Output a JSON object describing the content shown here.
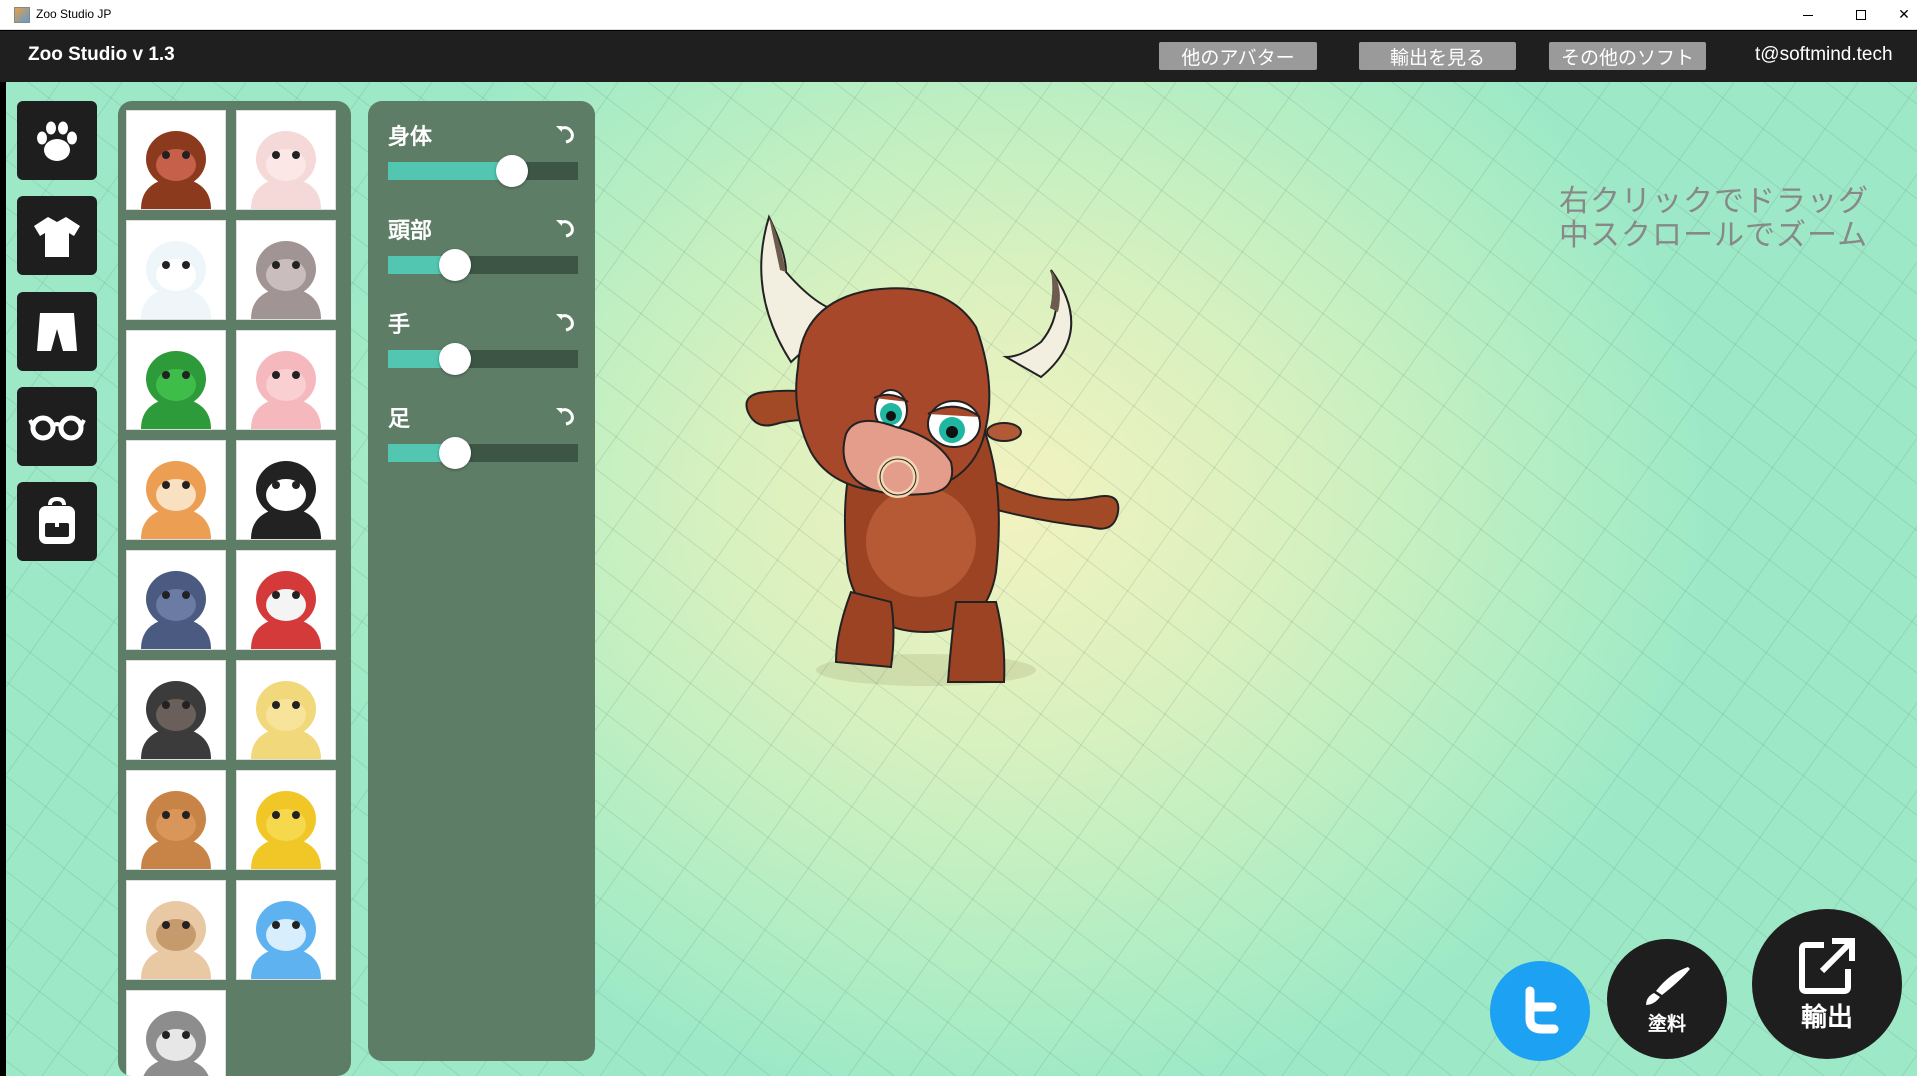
{
  "window": {
    "title": "Zoo Studio JP",
    "controls": [
      "minimize",
      "maximize",
      "close"
    ]
  },
  "header": {
    "app_title": "Zoo Studio v 1.3",
    "buttons": [
      "他のアバター",
      "輸出を見る",
      "その他のソフト"
    ],
    "email": "t@softmind.tech"
  },
  "categories": [
    {
      "icon": "paw-icon",
      "selected": true
    },
    {
      "icon": "shirt-icon"
    },
    {
      "icon": "pants-icon"
    },
    {
      "icon": "glasses-icon"
    },
    {
      "icon": "backpack-icon"
    }
  ],
  "avatars": [
    {
      "name": "bull",
      "color": "#8b3a1e",
      "face": "#c7604a"
    },
    {
      "name": "cat",
      "color": "#f5d8d8",
      "face": "#fbe8e6"
    },
    {
      "name": "polar-bear",
      "color": "#eef6fa",
      "face": "#ffffff"
    },
    {
      "name": "rabbit",
      "color": "#a09494",
      "face": "#c9bdbd"
    },
    {
      "name": "frog",
      "color": "#2d9b3a",
      "face": "#3fbd4b"
    },
    {
      "name": "pig",
      "color": "#f5b9bd",
      "face": "#f9cfd2"
    },
    {
      "name": "shiba",
      "color": "#ec9f52",
      "face": "#f8e0c0"
    },
    {
      "name": "panda",
      "color": "#222222",
      "face": "#ffffff"
    },
    {
      "name": "wolf",
      "color": "#4a5a80",
      "face": "#6a7ba4"
    },
    {
      "name": "rooster",
      "color": "#d43a3a",
      "face": "#f4f4f4"
    },
    {
      "name": "gorilla",
      "color": "#3b3b3b",
      "face": "#6a5f5a"
    },
    {
      "name": "banana",
      "color": "#f1d87a",
      "face": "#f7e49a"
    },
    {
      "name": "potato",
      "color": "#c88446",
      "face": "#d9965a"
    },
    {
      "name": "bee",
      "color": "#f1c727",
      "face": "#f6d84c"
    },
    {
      "name": "pug",
      "color": "#e9c9a3",
      "face": "#c59a6c"
    },
    {
      "name": "dolphin",
      "color": "#5eb2f0",
      "face": "#d8eefc"
    },
    {
      "name": "raccoon",
      "color": "#8d8d8d",
      "face": "#e7e7e7"
    }
  ],
  "sliders": [
    {
      "label": "身体",
      "value": 0.65
    },
    {
      "label": "頭部",
      "value": 0.35
    },
    {
      "label": "手",
      "value": 0.35
    },
    {
      "label": "足",
      "value": 0.35
    }
  ],
  "hint": {
    "line1": "右クリックでドラッグ",
    "line2": "中スクロールでズーム"
  },
  "actions": {
    "paint_label": "塗料",
    "export_label": "輸出"
  },
  "colors": {
    "panel": "#5e7d67",
    "slider_fill": "#52c6b0",
    "twitter": "#1da1f2"
  }
}
